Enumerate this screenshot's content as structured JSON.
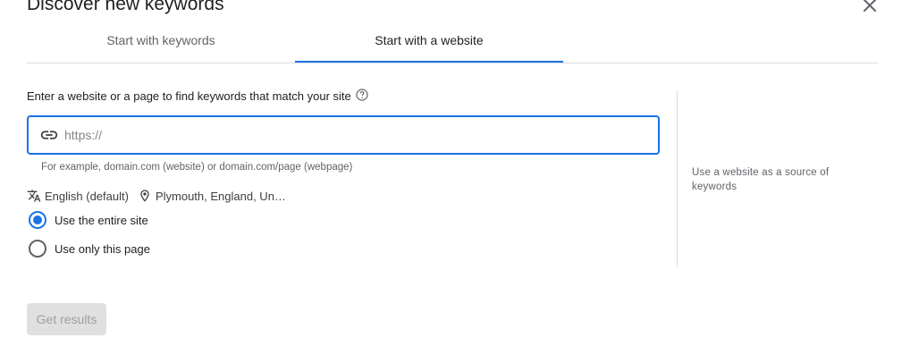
{
  "dialog": {
    "title": "Discover new keywords",
    "close_icon": "close-icon"
  },
  "tabs": [
    {
      "label": "Start with keywords",
      "selected": false
    },
    {
      "label": "Start with a website",
      "selected": true
    }
  ],
  "website": {
    "prompt": "Enter a website or a page to find keywords that match your site",
    "help_icon": "help-circle-icon",
    "url_input": {
      "value": "",
      "placeholder": "https://",
      "icon": "link-icon"
    },
    "hint": "For example, domain.com (website) or domain.com/page (webpage)"
  },
  "settings": {
    "language": {
      "label": "English (default)",
      "icon": "translate-icon"
    },
    "location": {
      "label": "Plymouth, England, Un…",
      "icon": "location-pin-icon"
    }
  },
  "scope_options": [
    {
      "label": "Use the entire site",
      "checked": true
    },
    {
      "label": "Use only this page",
      "checked": false
    }
  ],
  "side_panel": {
    "text": "Use a website as a source of keywords"
  },
  "actions": {
    "get_results": "Get results",
    "get_results_enabled": false
  },
  "colors": {
    "accent": "#1a73e8",
    "divider": "#dadce0",
    "disabled_bg": "#e0e0e0",
    "disabled_text": "#9aa0a6"
  }
}
